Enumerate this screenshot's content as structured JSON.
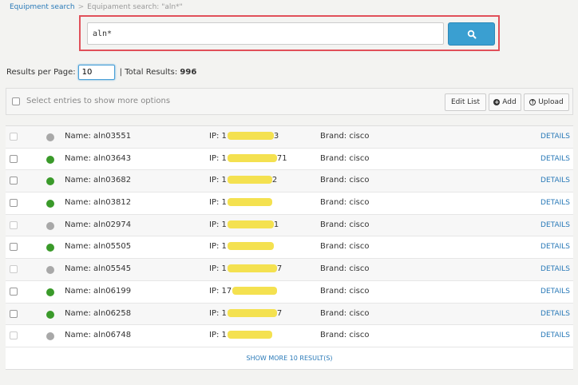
{
  "breadcrumb": {
    "root": "Equipment search",
    "separator": ">",
    "current": "Equipament search: \"aln*\""
  },
  "search": {
    "value": "aln*",
    "button_icon": "search-icon"
  },
  "results": {
    "per_page_label": "Results per Page:",
    "per_page_value": "10",
    "total_label": "| Total Results:",
    "total_value": "996"
  },
  "toolbar": {
    "select_label": "Select entries to show more options",
    "edit_list": "Edit List",
    "add": "Add",
    "upload": "Upload"
  },
  "rows": [
    {
      "name": "Name: aln03551",
      "ip_prefix": "IP: 1",
      "ip_suffix": "3",
      "brand": "Brand: cisco",
      "status": "#a8a8a8",
      "details": "DETAILS"
    },
    {
      "name": "Name: aln03643",
      "ip_prefix": "IP: 1",
      "ip_suffix": "71",
      "brand": "Brand: cisco",
      "status": "#3a9a2a",
      "details": "DETAILS"
    },
    {
      "name": "Name: aln03682",
      "ip_prefix": "IP: 1",
      "ip_suffix": "2",
      "brand": "Brand: cisco",
      "status": "#3a9a2a",
      "details": "DETAILS"
    },
    {
      "name": "Name: aln03812",
      "ip_prefix": "IP: 1",
      "ip_suffix": "",
      "brand": "Brand: cisco",
      "status": "#3a9a2a",
      "details": "DETAILS"
    },
    {
      "name": "Name: aln02974",
      "ip_prefix": "IP: 1",
      "ip_suffix": "1",
      "brand": "Brand: cisco",
      "status": "#a8a8a8",
      "details": "DETAILS"
    },
    {
      "name": "Name: aln05505",
      "ip_prefix": "IP: 1",
      "ip_suffix": "",
      "brand": "Brand: cisco",
      "status": "#3a9a2a",
      "details": "DETAILS"
    },
    {
      "name": "Name: aln05545",
      "ip_prefix": "IP: 1",
      "ip_suffix": "7",
      "brand": "Brand: cisco",
      "status": "#a8a8a8",
      "details": "DETAILS"
    },
    {
      "name": "Name: aln06199",
      "ip_prefix": "IP: 17",
      "ip_suffix": "",
      "brand": "Brand: cisco",
      "status": "#3a9a2a",
      "details": "DETAILS"
    },
    {
      "name": "Name: aln06258",
      "ip_prefix": "IP: 1",
      "ip_suffix": "7",
      "brand": "Brand: cisco",
      "status": "#3a9a2a",
      "details": "DETAILS"
    },
    {
      "name": "Name: aln06748",
      "ip_prefix": "IP: 1",
      "ip_suffix": "",
      "brand": "Brand: cisco",
      "status": "#a8a8a8",
      "details": "DETAILS"
    }
  ],
  "show_more": "SHOW MORE 10 RESULT(S)"
}
